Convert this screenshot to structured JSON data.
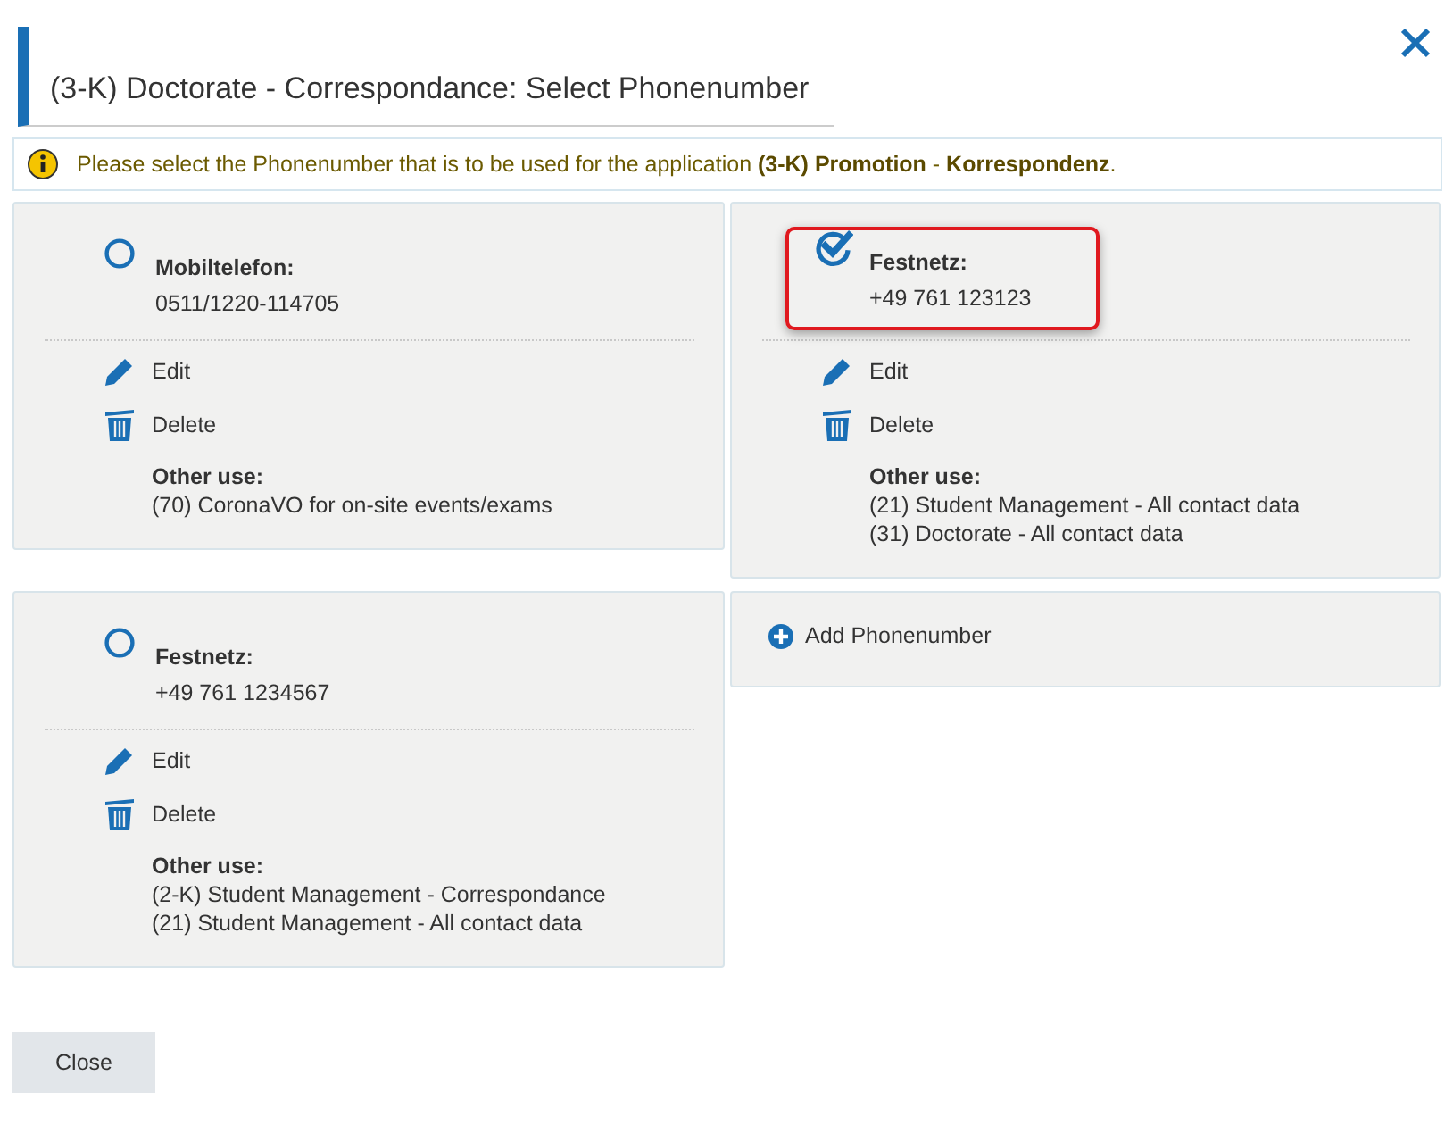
{
  "dialog": {
    "title": "(3-K) Doctorate - Correspondance: Select Phonenumber"
  },
  "info": {
    "text": "Please select the Phonenumber that is to be used for the application **(3-K) Promotion** - **Korrespondenz**."
  },
  "numbers": [
    {
      "type": "Mobiltelefon:",
      "number": "0511/1220-114705",
      "selected": false,
      "highlighted": false,
      "edit": "Edit",
      "delete": "Delete",
      "other_use_label": "Other use:",
      "other_uses": [
        "(70) CoronaVO for on-site events/exams"
      ]
    },
    {
      "type": "Festnetz:",
      "number": "+49 761 123123",
      "selected": true,
      "highlighted": true,
      "edit": "Edit",
      "delete": "Delete",
      "other_use_label": "Other use:",
      "other_uses": [
        "(21) Student Management - All contact data",
        "(31) Doctorate - All contact data"
      ]
    },
    {
      "type": "Festnetz:",
      "number": "+49 761 1234567",
      "selected": false,
      "highlighted": false,
      "edit": "Edit",
      "delete": "Delete",
      "other_use_label": "Other use:",
      "other_uses": [
        "(2-K) Student Management - Correspondance",
        "(21) Student Management - All contact data"
      ]
    }
  ],
  "add_button": "Add Phonenumber",
  "buttons": [
    "Close"
  ]
}
